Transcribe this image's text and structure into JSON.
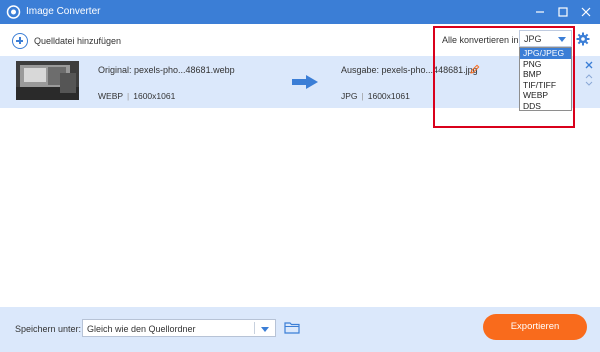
{
  "window": {
    "title": "Image Converter",
    "logo_icon": "camera-converter-logo",
    "accent_color": "#3b7ed6"
  },
  "toolbar": {
    "add_source_label": "Quelldatei hinzufügen",
    "convert_all_label": "Alle konvertieren in:",
    "selected_format": "JPG"
  },
  "format_dropdown": {
    "options": [
      "JPG/JPEG",
      "PNG",
      "BMP",
      "TIF/TIFF",
      "WEBP",
      "DDS"
    ],
    "selected_index": 0
  },
  "file": {
    "original_label": "Original: pexels-pho...48681.webp",
    "original_format": "WEBP",
    "original_resolution": "1600x1061",
    "output_label": "Ausgabe: pexels-pho...448681.jpg",
    "output_format": "JPG",
    "output_resolution": "1600x1061"
  },
  "footer": {
    "save_to_label": "Speichern unter:",
    "save_location": "Gleich wie den Quellordner",
    "convert_button": "Exportieren",
    "convert_button_color": "#f96b1c"
  }
}
